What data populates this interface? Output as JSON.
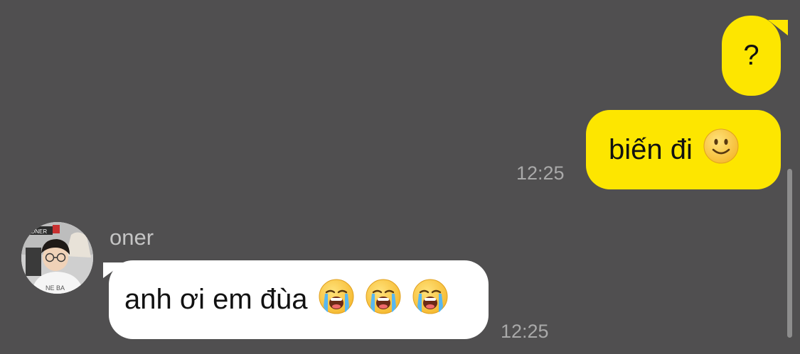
{
  "messages": [
    {
      "direction": "outgoing",
      "text": "?"
    },
    {
      "direction": "outgoing",
      "text": "biến đi",
      "emoji": "slightly-smiling-face",
      "time": "12:25"
    },
    {
      "direction": "incoming",
      "sender": "oner",
      "text": "anh ơi em đùa",
      "emojis": [
        "loudly-crying-face",
        "loudly-crying-face",
        "loudly-crying-face"
      ],
      "time": "12:25"
    }
  ],
  "colors": {
    "background": "#504f50",
    "outgoing_bubble": "#fde600",
    "incoming_bubble": "#ffffff",
    "timestamp": "#a9a9a9",
    "sender_name": "#c4c4c4"
  }
}
